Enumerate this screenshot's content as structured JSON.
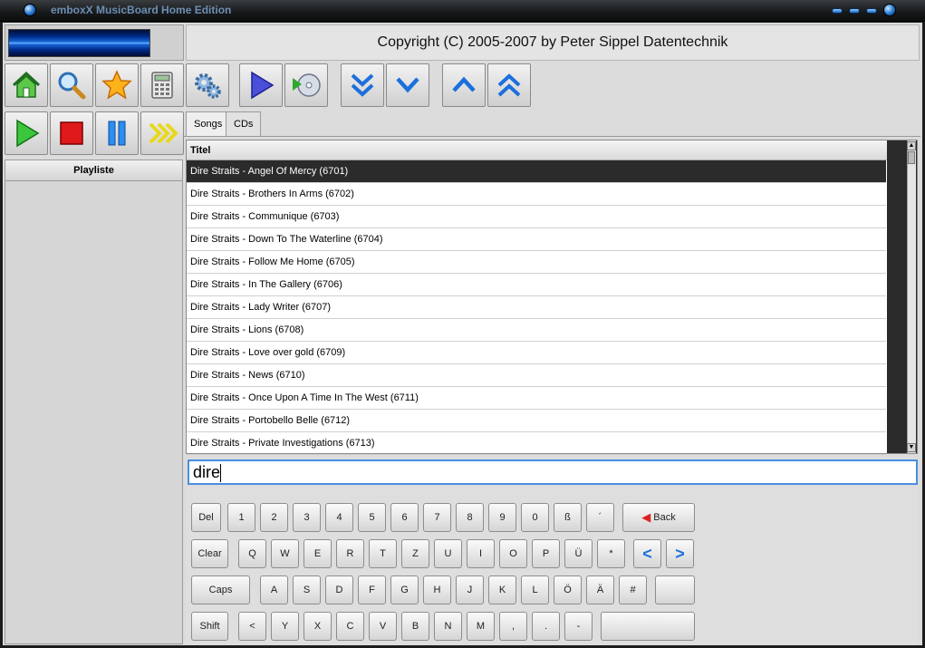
{
  "window": {
    "title": "emboxX MusicBoard Home Edition"
  },
  "header": {
    "copyright": "Copyright (C) 2005-2007 by Peter Sippel Datentechnik"
  },
  "toolbar": {
    "buttons": [
      {
        "name": "home-button",
        "icon": "home-icon"
      },
      {
        "name": "search-button",
        "icon": "magnifier-icon"
      },
      {
        "name": "favorites-button",
        "icon": "star-icon"
      },
      {
        "name": "calculator-button",
        "icon": "calculator-icon"
      },
      {
        "name": "settings-button",
        "icon": "gears-icon"
      },
      {
        "name": "play-list-button",
        "icon": "play-icon"
      },
      {
        "name": "play-cd-button",
        "icon": "cd-play-icon"
      },
      {
        "name": "page-down-button",
        "icon": "double-chevron-down-icon"
      },
      {
        "name": "line-down-button",
        "icon": "chevron-down-icon"
      },
      {
        "name": "line-up-button",
        "icon": "chevron-up-icon"
      },
      {
        "name": "page-up-button",
        "icon": "double-chevron-up-icon"
      }
    ]
  },
  "player": {
    "buttons": [
      {
        "name": "play-button",
        "icon": "play-icon"
      },
      {
        "name": "stop-button",
        "icon": "stop-icon"
      },
      {
        "name": "pause-button",
        "icon": "pause-icon"
      },
      {
        "name": "fast-forward-button",
        "icon": "fast-forward-icon"
      }
    ]
  },
  "playlist": {
    "header": "Playliste"
  },
  "tabs": [
    {
      "label": "Songs",
      "active": true
    },
    {
      "label": "CDs",
      "active": false
    }
  ],
  "songs": {
    "column_header": "Titel",
    "rows": [
      "Dire Straits - Angel Of Mercy (6701)",
      "Dire Straits - Brothers In Arms (6702)",
      "Dire Straits - Communique (6703)",
      "Dire Straits - Down To The Waterline (6704)",
      "Dire Straits - Follow Me Home (6705)",
      "Dire Straits - In The Gallery (6706)",
      "Dire Straits - Lady Writer (6707)",
      "Dire Straits - Lions (6708)",
      "Dire Straits - Love over gold (6709)",
      "Dire Straits - News (6710)",
      "Dire Straits - Once Upon A Time In The West (6711)",
      "Dire Straits - Portobello Belle (6712)",
      "Dire Straits - Private Investigations (6713)"
    ],
    "selected_index": 0
  },
  "search": {
    "value": "dire"
  },
  "keyboard": {
    "row1": [
      "1",
      "2",
      "3",
      "4",
      "5",
      "6",
      "7",
      "8",
      "9",
      "0",
      "ß",
      "´"
    ],
    "row2": [
      "Q",
      "W",
      "E",
      "R",
      "T",
      "Z",
      "U",
      "I",
      "O",
      "P",
      "Ü",
      "*"
    ],
    "row3": [
      "A",
      "S",
      "D",
      "F",
      "G",
      "H",
      "J",
      "K",
      "L",
      "Ö",
      "Ä",
      "#"
    ],
    "row4": [
      "<",
      "Y",
      "X",
      "C",
      "V",
      "B",
      "N",
      "M",
      ",",
      ".",
      "-"
    ],
    "del": "Del",
    "clear": "Clear",
    "caps": "Caps",
    "shift": "Shift",
    "back": "Back"
  },
  "colors": {
    "accent": "#1c6fdc",
    "selection": "#2b2b2b",
    "frame": "#dcdcdc"
  }
}
